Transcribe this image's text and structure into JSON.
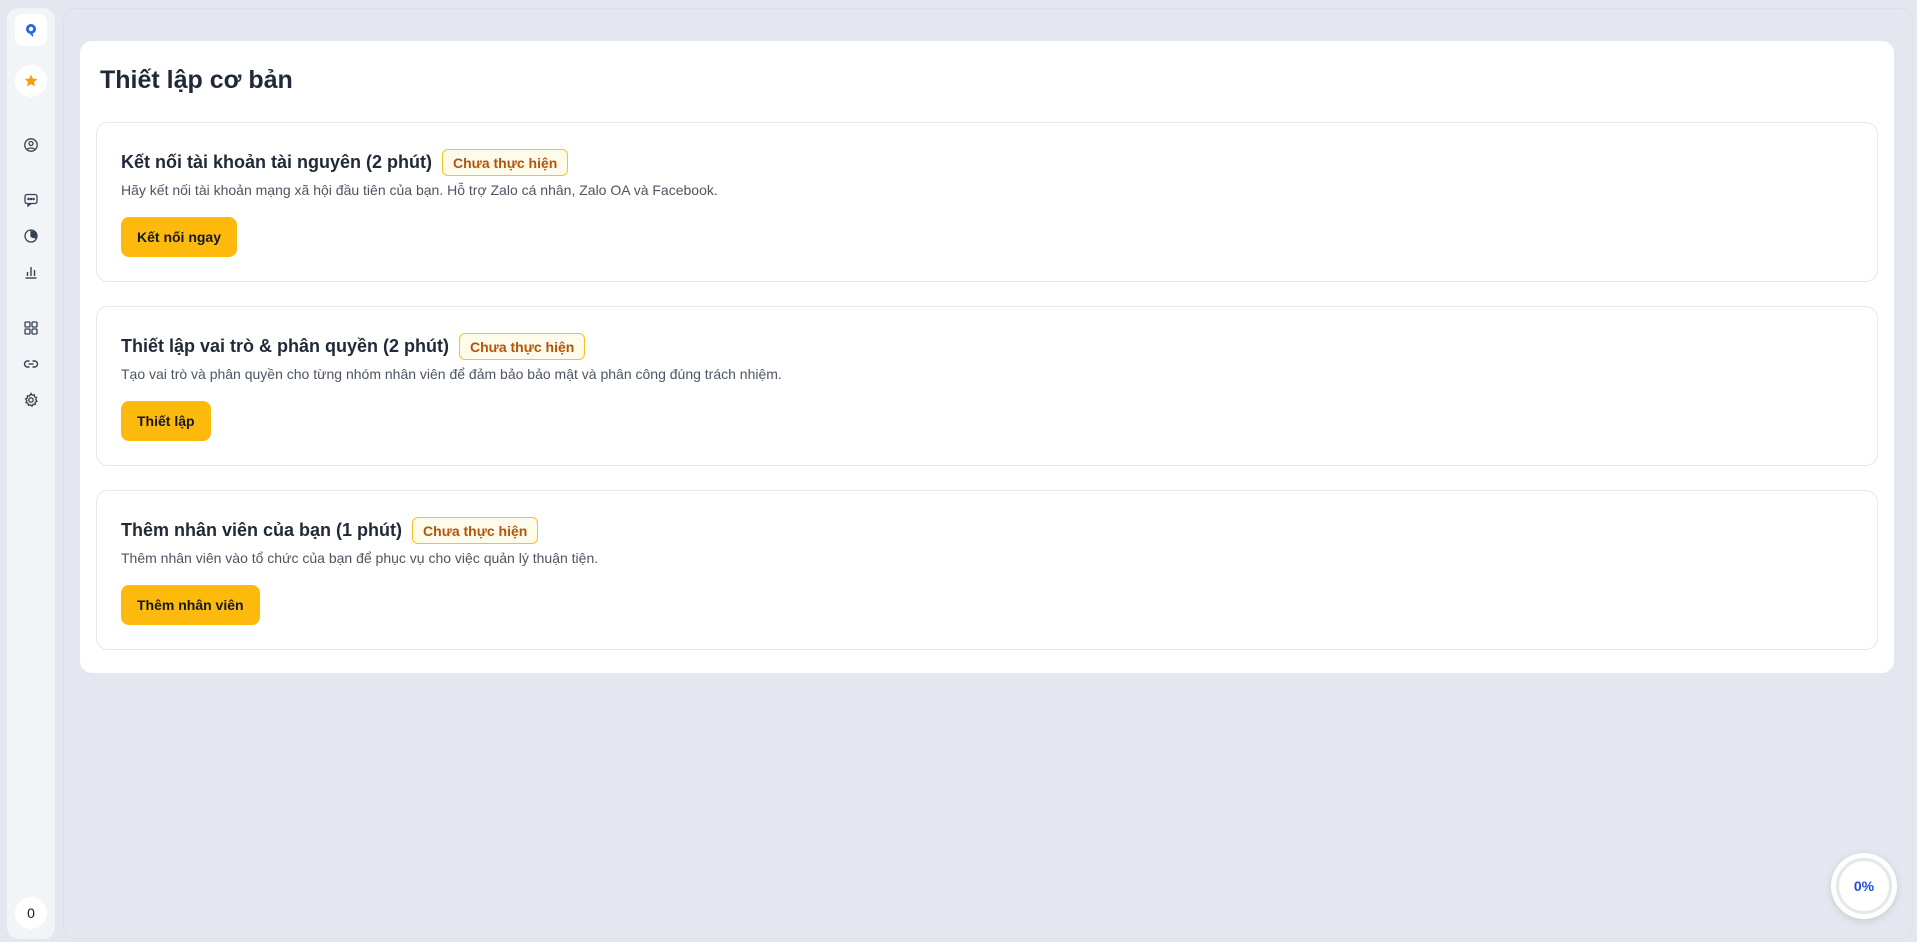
{
  "sidebar": {
    "icons": [
      "logo-icon",
      "star-icon",
      "user-circle-icon",
      "chat-icon",
      "pie-chart-icon",
      "bar-chart-icon",
      "apps-grid-icon",
      "link-icon",
      "gear-icon"
    ],
    "counter": "0"
  },
  "page": {
    "title": "Thiết lập cơ bản"
  },
  "steps": [
    {
      "title": "Kết nối tài khoản tài nguyên (2 phút)",
      "status": "Chưa thực hiện",
      "description": "Hãy kết nối tài khoản mạng xã hội đầu tiên của bạn. Hỗ trợ Zalo cá nhân, Zalo OA và Facebook.",
      "button": "Kết nối ngay"
    },
    {
      "title": "Thiết lập vai trò & phân quyền (2 phút)",
      "status": "Chưa thực hiện",
      "description": "Tạo vai trò và phân quyền cho từng nhóm nhân viên để đảm bảo bảo mật và phân công đúng trách nhiệm.",
      "button": "Thiết lập"
    },
    {
      "title": "Thêm nhân viên của bạn (1 phút)",
      "status": "Chưa thực hiện",
      "description": "Thêm nhân viên vào tổ chức của bạn để phục vụ cho việc quản lý thuận tiện.",
      "button": "Thêm nhân viên"
    }
  ],
  "progress": {
    "value": 0,
    "label": "0%"
  },
  "colors": {
    "accent": "#fdb90c",
    "badge_text": "#b45309",
    "badge_border": "#fbbf24",
    "progress_text": "#1d4ed8",
    "background": "#e4e7ef"
  }
}
